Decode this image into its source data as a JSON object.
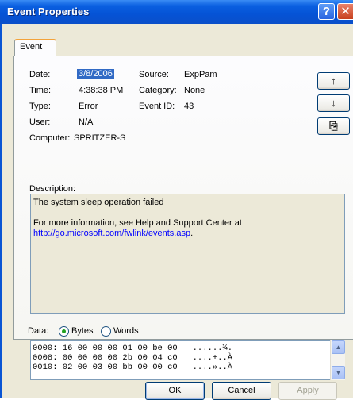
{
  "window": {
    "title": "Event Properties",
    "help_glyph": "?",
    "close_glyph": "✕"
  },
  "tabs": [
    {
      "label": "Event"
    }
  ],
  "event": {
    "date_label": "Date:",
    "date": "3/8/2006",
    "time_label": "Time:",
    "time": "4:38:38 PM",
    "type_label": "Type:",
    "type": "Error",
    "user_label": "User:",
    "user": "N/A",
    "computer_label": "Computer:",
    "computer": "SPRITZER-S",
    "source_label": "Source:",
    "source": "ExpPam",
    "category_label": "Category:",
    "category": "None",
    "event_id_label": "Event ID:",
    "event_id": "43"
  },
  "nav": {
    "up_glyph": "↑",
    "down_glyph": "↓",
    "copy_glyph": "⎘"
  },
  "description": {
    "label": "Description:",
    "line1": "The system sleep operation failed",
    "line2": "For more information, see Help and Support Center at",
    "link": "http://go.microsoft.com/fwlink/events.asp",
    "link_suffix": "."
  },
  "data": {
    "label": "Data:",
    "bytes_label": "Bytes",
    "words_label": "Words",
    "selected": "Bytes",
    "rows": [
      "0000: 16 00 00 00 01 00 be 00   ......¾.",
      "0008: 00 00 00 00 2b 00 04 c0   ....+..À",
      "0010: 02 00 03 00 bb 00 00 c0   ....»..À"
    ]
  },
  "buttons": {
    "ok": "OK",
    "cancel": "Cancel",
    "apply": "Apply"
  },
  "colors": {
    "titlebar": "#0553d6",
    "dialog_bg": "#ece9d8",
    "selection": "#316ac5",
    "tab_accent": "#f3a33b"
  }
}
